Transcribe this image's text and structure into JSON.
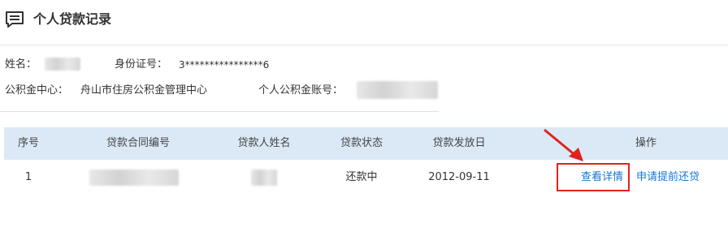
{
  "header": {
    "title": "个人贷款记录",
    "icon": "message-list-icon"
  },
  "info": {
    "name_label": "姓名：",
    "id_label": "身份证号：",
    "id_value": "3****************6",
    "center_label": "公积金中心：",
    "center_value": "舟山市住房公积金管理中心",
    "account_label": "个人公积金账号："
  },
  "table": {
    "columns": [
      "序号",
      "贷款合同编号",
      "贷款人姓名",
      "贷款状态",
      "贷款发放日",
      "操作"
    ],
    "rows": [
      {
        "index": "1",
        "status": "还款中",
        "issue_date": "2012-09-11",
        "action_detail": "查看详情",
        "action_prepay": "申请提前还贷"
      }
    ]
  },
  "colors": {
    "accent": "#1777d1",
    "header_bg": "#dbe9f7",
    "highlight": "#e0231f"
  }
}
